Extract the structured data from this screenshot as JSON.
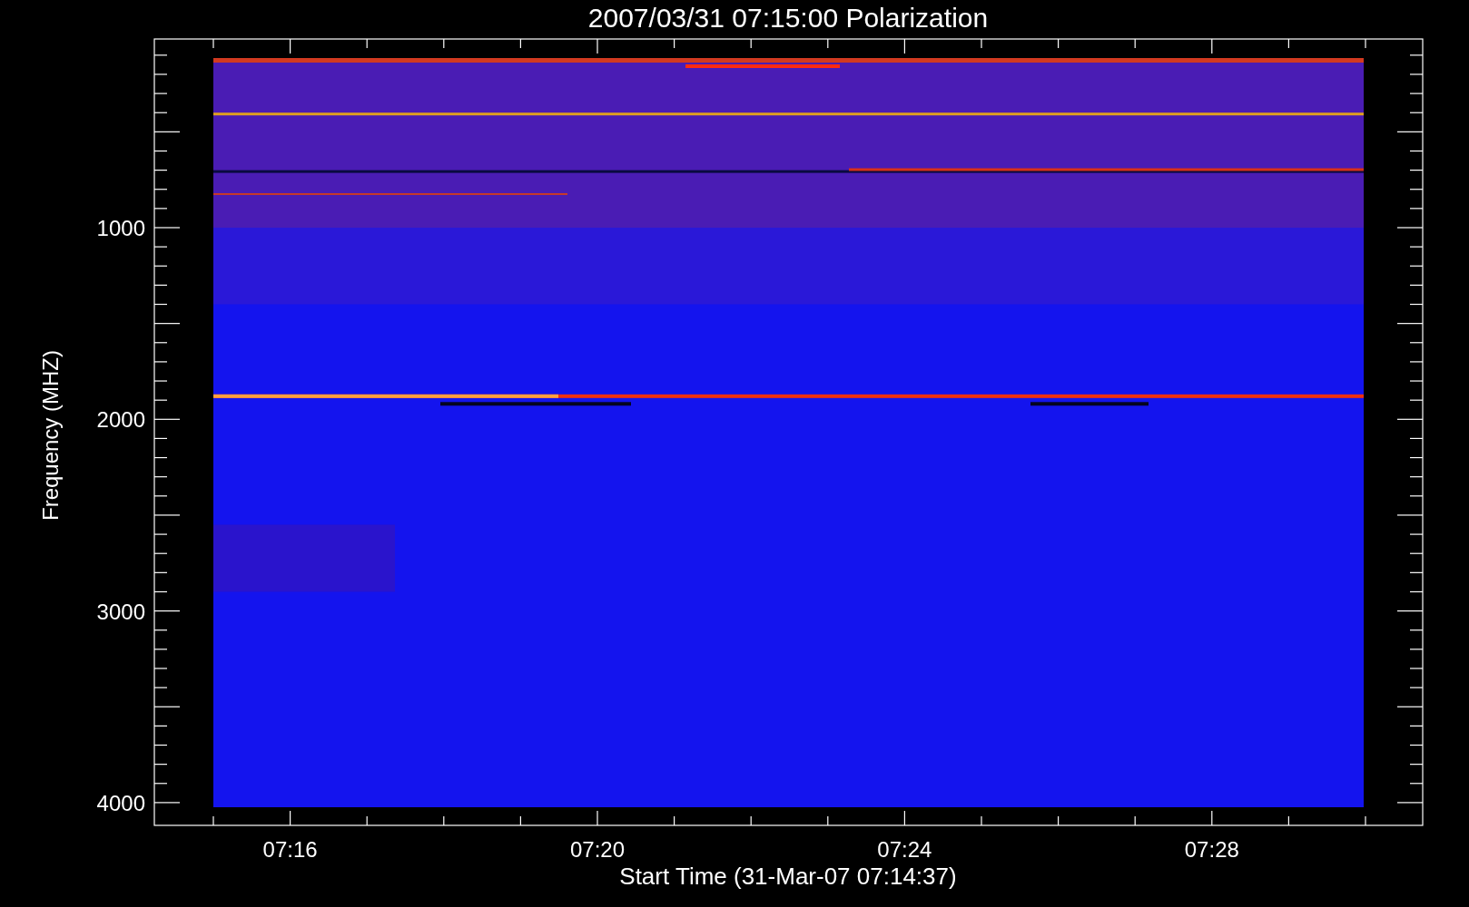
{
  "title": "2007/03/31 07:15:00 Polarization",
  "y_axis": {
    "label": "Frequency (MHZ)",
    "ticks": [
      "1000",
      "2000",
      "3000",
      "4000"
    ]
  },
  "x_axis": {
    "label": "Start Time (31-Mar-07 07:14:37)",
    "ticks": [
      "07:16",
      "07:20",
      "07:24",
      "07:28"
    ]
  }
}
